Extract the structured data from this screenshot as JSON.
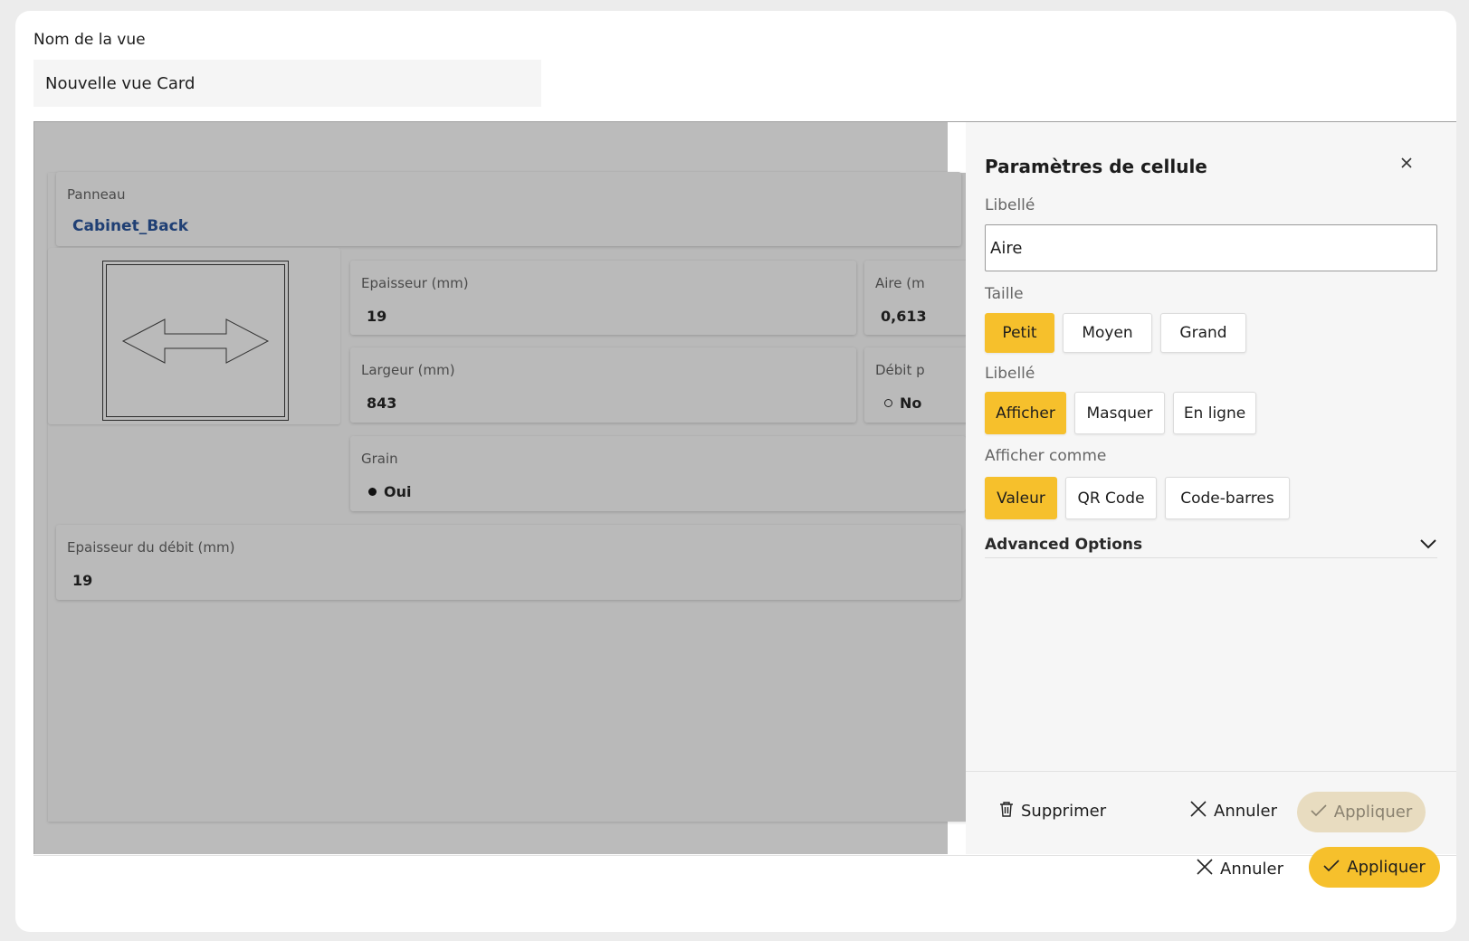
{
  "view_name": {
    "label": "Nom de la vue",
    "value": "Nouvelle vue Card"
  },
  "card": {
    "panel_label": "Panneau",
    "panel_value": "Cabinet_Back",
    "cells": [
      {
        "label": "Epaisseur (mm)",
        "value": "19"
      },
      {
        "label": "Aire (m",
        "value": "0,613"
      },
      {
        "label": "Largeur (mm)",
        "value": "843"
      },
      {
        "label": "Débit p",
        "value": "No"
      },
      {
        "label": "Grain",
        "value": "Oui"
      },
      {
        "label": "Epaisseur du débit (mm)",
        "value": "19"
      }
    ]
  },
  "panel": {
    "title": "Paramètres de cellule",
    "label_section": "Libellé",
    "label_value": "Aire",
    "size_section": "Taille",
    "size_options": [
      "Petit",
      "Moyen",
      "Grand"
    ],
    "size_selected": "Petit",
    "display_label_section": "Libellé",
    "display_label_options": [
      "Afficher",
      "Masquer",
      "En ligne"
    ],
    "display_label_selected": "Afficher",
    "show_as_section": "Afficher comme",
    "show_as_options": [
      "Valeur",
      "QR Code",
      "Code-barres"
    ],
    "show_as_selected": "Valeur",
    "advanced_label": "Advanced Options",
    "delete_label": "Supprimer",
    "cancel_label": "Annuler",
    "apply_label": "Appliquer"
  },
  "footer": {
    "cancel_label": "Annuler",
    "apply_label": "Appliquer"
  },
  "colors": {
    "accent": "#f6c02c",
    "link": "#1f3f74",
    "overlay": "#bbbbbb"
  }
}
